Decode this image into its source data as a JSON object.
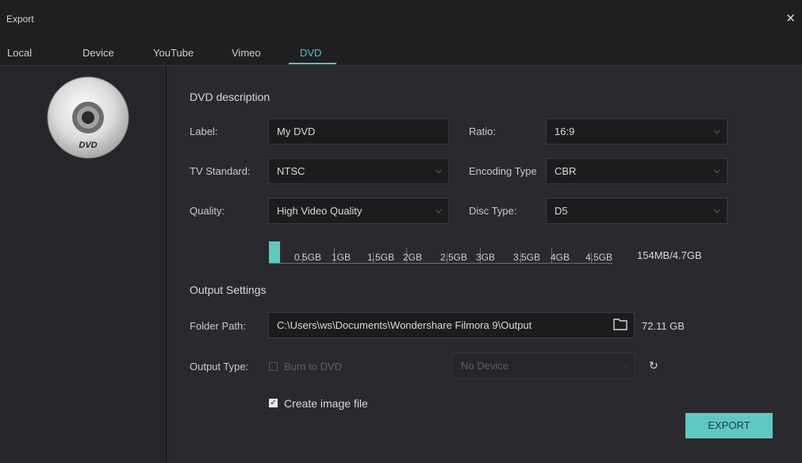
{
  "window": {
    "title": "Export",
    "close_icon": "close-icon"
  },
  "tabs": [
    {
      "label": "Local"
    },
    {
      "label": "Device"
    },
    {
      "label": "YouTube"
    },
    {
      "label": "Vimeo"
    },
    {
      "label": "DVD",
      "active": true
    }
  ],
  "sidebar": {
    "disc_label": "DVD"
  },
  "dvd_description": {
    "title": "DVD description",
    "label_label": "Label:",
    "label_value": "My DVD",
    "ratio_label": "Ratio:",
    "ratio_value": "16:9",
    "tv_standard_label": "TV Standard:",
    "tv_standard_value": "NTSC",
    "encoding_type_label": "Encoding Type",
    "encoding_type_value": "CBR",
    "quality_label": "Quality:",
    "quality_value": "High Video Quality",
    "disc_type_label": "Disc Type:",
    "disc_type_value": "D5"
  },
  "capacity": {
    "ticks": [
      "0.5GB",
      "1GB",
      "1.5GB",
      "2GB",
      "2.5GB",
      "3GB",
      "3.5GB",
      "4GB",
      "4.5GB"
    ],
    "usage_text": "154MB/4.7GB",
    "used_fraction": 0.033,
    "fill_color": "#5fc8c0"
  },
  "output_settings": {
    "title": "Output Settings",
    "folder_path_label": "Folder Path:",
    "folder_path_value": "C:\\Users\\ws\\Documents\\Wondershare Filmora 9\\Output",
    "free_space": "72.11 GB",
    "output_type_label": "Output Type:",
    "burn_to_dvd_label": "Burn to DVD",
    "burn_to_dvd_checked": false,
    "device_value": "No Device",
    "create_image_label": "Create image file",
    "create_image_checked": true
  },
  "actions": {
    "export_label": "EXPORT",
    "accent_color": "#5fc8c0"
  }
}
